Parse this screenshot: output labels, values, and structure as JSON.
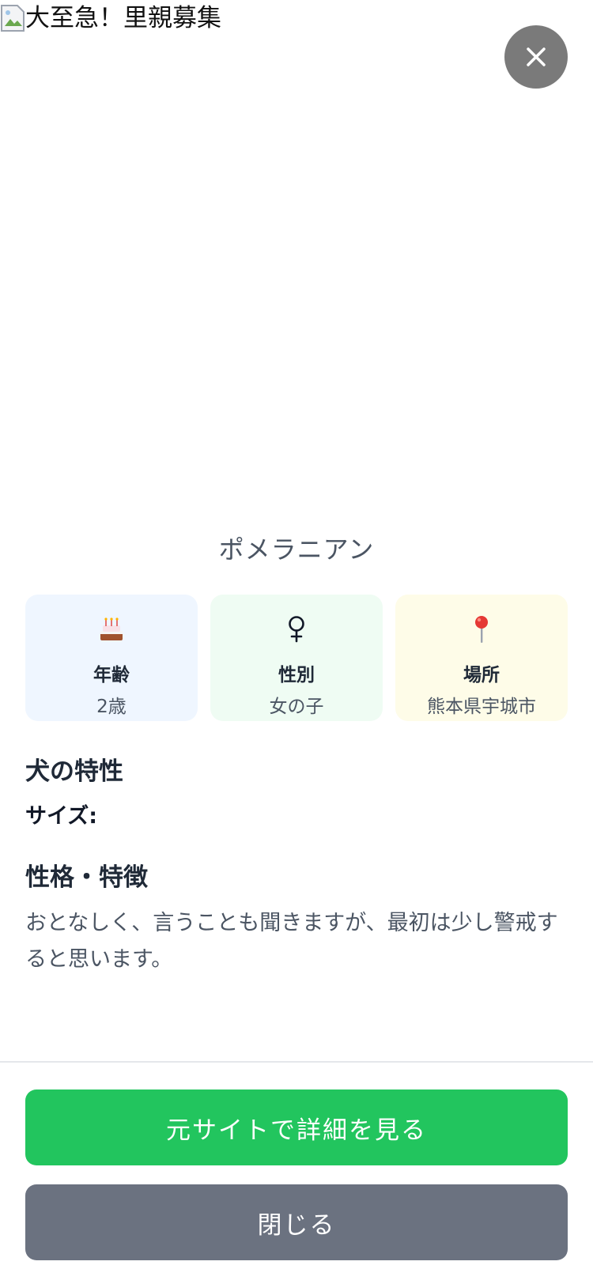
{
  "hero": {
    "image_alt": "大至急！里親募集"
  },
  "close_fab": {
    "icon": "close-icon"
  },
  "breed": "ポメラニアン",
  "info_cards": [
    {
      "icon": "cake-icon",
      "label": "年齢",
      "value": "2歳"
    },
    {
      "icon": "female-icon",
      "label": "性別",
      "value": "女の子"
    },
    {
      "icon": "pin-icon",
      "label": "場所",
      "value": "熊本県宇城市"
    }
  ],
  "traits": {
    "title": "犬の特性",
    "size_label": "サイズ:"
  },
  "personality": {
    "title": "性格・特徴",
    "text": "おとなしく、言うことも聞きますが、最初は少し警戒すると思います。"
  },
  "footer": {
    "primary_label": "元サイトで詳細を見る",
    "secondary_label": "閉じる"
  },
  "colors": {
    "primary": "#22c55e",
    "secondary": "#6b7280",
    "age_card": "#eff6ff",
    "sex_card": "#effcf3",
    "loc_card": "#fefce8"
  }
}
